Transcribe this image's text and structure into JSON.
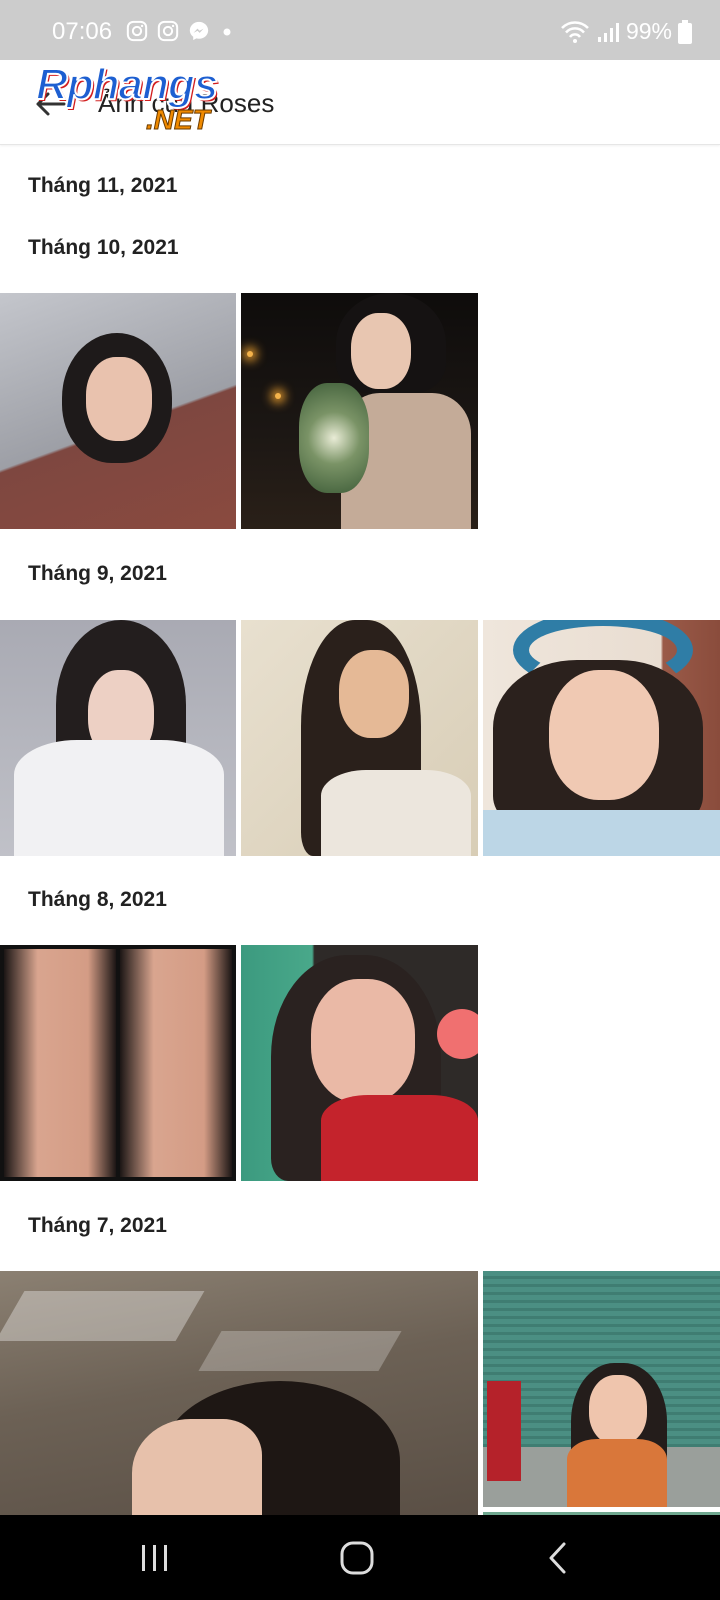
{
  "status_bar": {
    "time": "07:06",
    "battery": "99%",
    "icons": [
      "instagram-icon",
      "instagram-icon",
      "messenger-icon",
      "dot-icon",
      "wifi-icon",
      "signal-icon",
      "battery-icon"
    ]
  },
  "app_bar": {
    "title": "Ảnh của Roses"
  },
  "watermark": {
    "line1": "Rphangs",
    "line2": ".NET"
  },
  "sections": [
    {
      "label": "Tháng 11, 2021",
      "photos": []
    },
    {
      "label": "Tháng 10, 2021",
      "photos": [
        "photo",
        "photo"
      ]
    },
    {
      "label": "Tháng 9, 2021",
      "photos": [
        "photo",
        "photo",
        "photo"
      ]
    },
    {
      "label": "Tháng 8, 2021",
      "photos": [
        "photo",
        "photo"
      ]
    },
    {
      "label": "Tháng 7, 2021",
      "photos": [
        "photo",
        "photo"
      ]
    }
  ],
  "nav_bar": {
    "buttons": [
      "recent-apps",
      "home",
      "back"
    ]
  },
  "colors": {
    "status_bar_bg": "#cccccc",
    "nav_bar_bg": "#000000",
    "text": "#222222"
  }
}
